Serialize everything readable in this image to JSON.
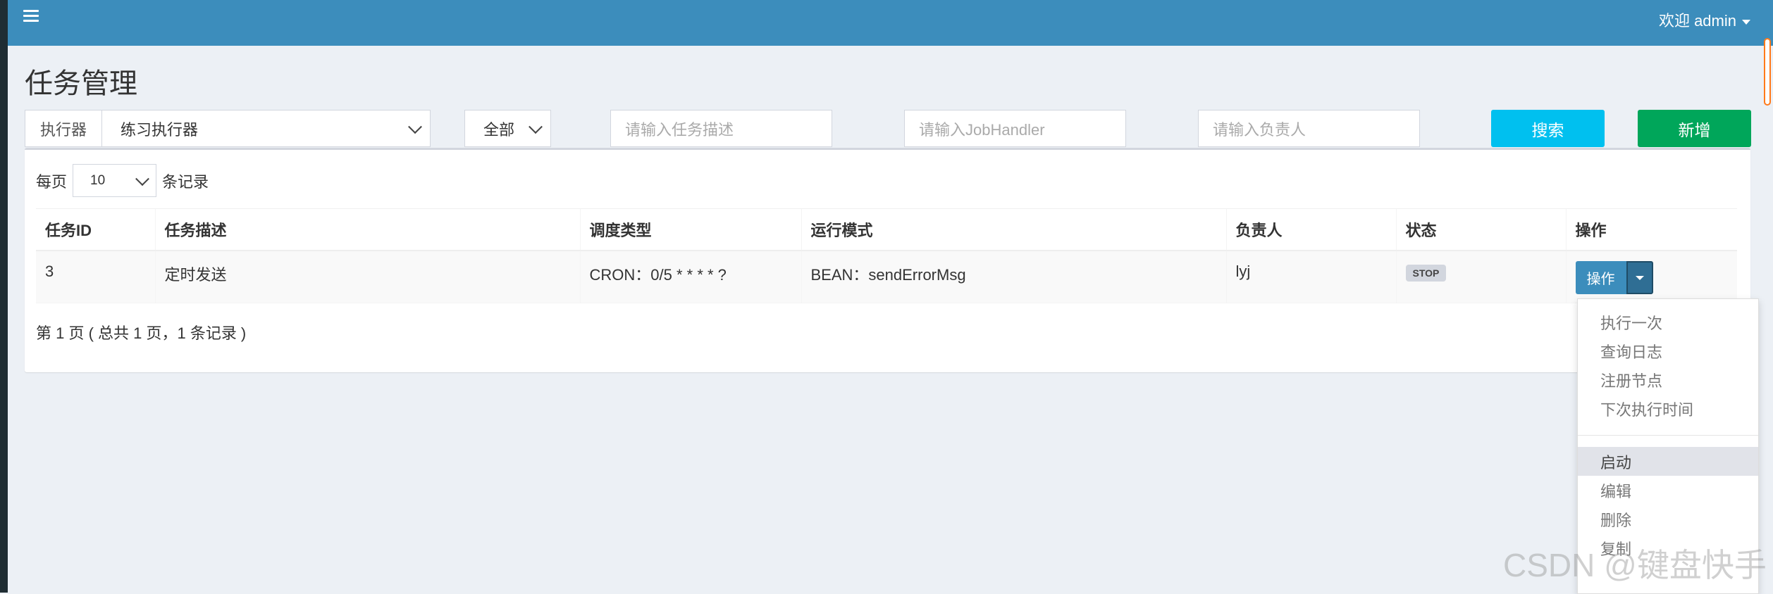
{
  "header": {
    "user_label": "欢迎 admin"
  },
  "page": {
    "title": "任务管理"
  },
  "filters": {
    "executor_label": "执行器",
    "executor_value": "练习执行器",
    "status_value": "全部",
    "desc_placeholder": "请输入任务描述",
    "handler_placeholder": "请输入JobHandler",
    "author_placeholder": "请输入负责人",
    "search_label": "搜索",
    "add_label": "新增"
  },
  "pagination": {
    "prefix": "每页",
    "size": "10",
    "suffix": "条记录",
    "info": "第 1 页 ( 总共 1 页，1 条记录 )"
  },
  "table": {
    "headers": [
      "任务ID",
      "任务描述",
      "调度类型",
      "运行模式",
      "负责人",
      "状态",
      "操作"
    ],
    "rows": [
      {
        "id": "3",
        "desc": "定时发送",
        "schedule": "CRON：0/5 * * * * ?",
        "mode": "BEAN：sendErrorMsg",
        "author": "lyj",
        "status": "STOP",
        "action": "操作"
      }
    ]
  },
  "dropdown": {
    "group1": [
      "执行一次",
      "查询日志",
      "注册节点",
      "下次执行时间"
    ],
    "group2": [
      "启动",
      "编辑",
      "删除",
      "复制"
    ]
  },
  "watermark": "CSDN @键盘快手",
  "colors": {
    "header": "#3c8dbc",
    "search": "#00c0ef",
    "add": "#00a65a",
    "background": "#ecf0f5"
  }
}
